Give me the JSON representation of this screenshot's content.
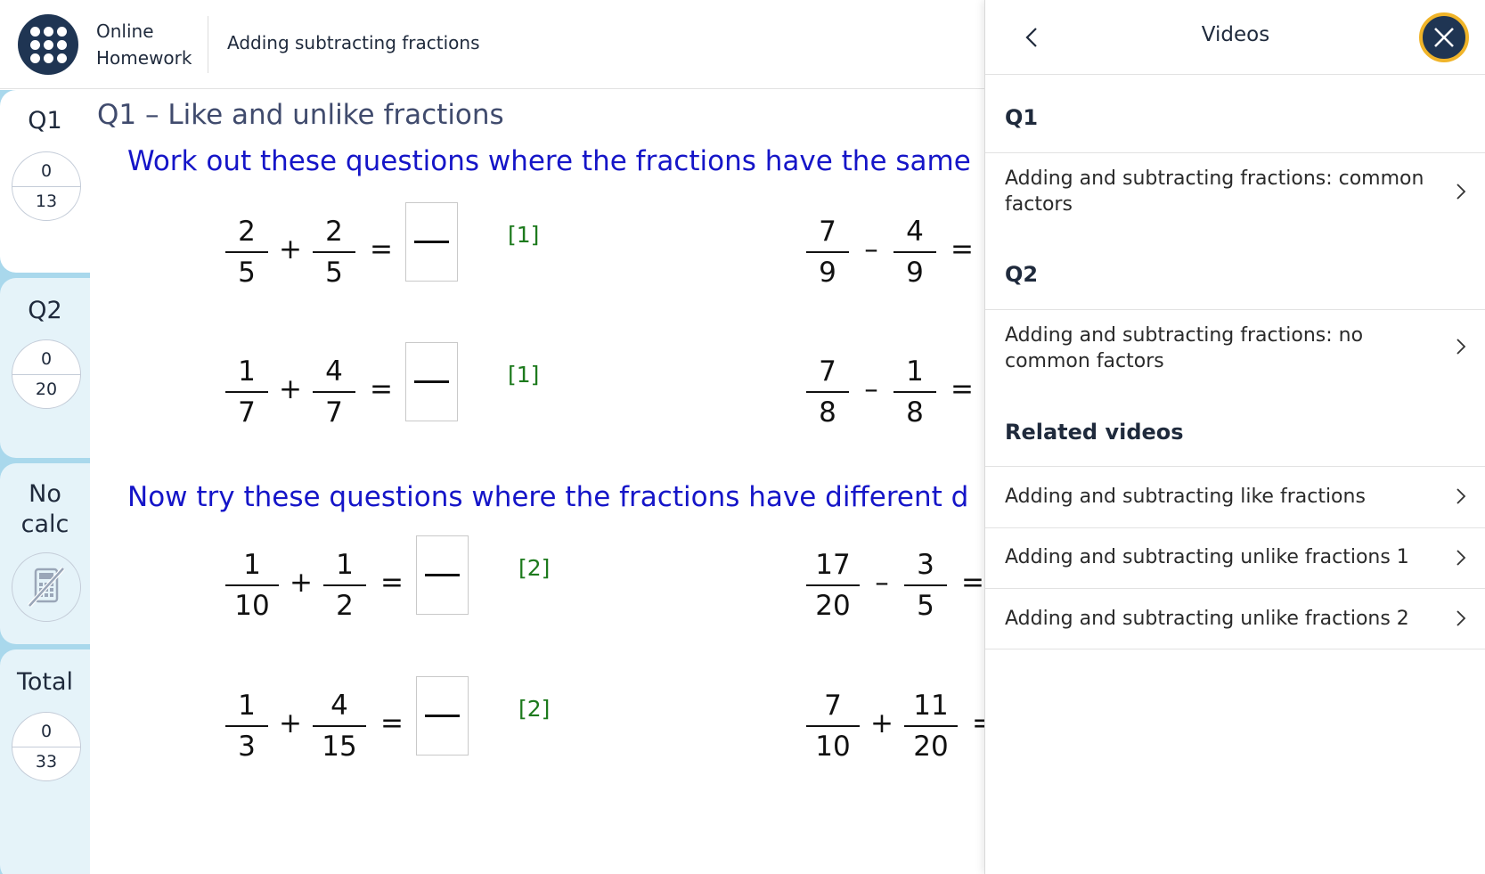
{
  "header": {
    "brand_line1": "Online",
    "brand_line2": "Homework",
    "homework_title": "Adding subtracting fractions"
  },
  "sidebar": {
    "items": [
      {
        "label": "Q1",
        "score": "0",
        "total": "13"
      },
      {
        "label": "Q2",
        "score": "0",
        "total": "20"
      },
      {
        "label_line1": "No",
        "label_line2": "calc",
        "icon": "calculator-off-icon"
      },
      {
        "label": "Total",
        "score": "0",
        "total": "33"
      }
    ]
  },
  "main": {
    "heading": "Q1 – Like and unlike fractions",
    "instruction1": "Work out these questions where the fractions have the same",
    "instruction2": "Now try these questions where the fractions have different d",
    "equals": "=",
    "problems": [
      {
        "a_num": "2",
        "a_den": "5",
        "op": "+",
        "b_num": "2",
        "b_den": "5",
        "marks": "[1]"
      },
      {
        "a_num": "7",
        "a_den": "9",
        "op": "–",
        "b_num": "4",
        "b_den": "9"
      },
      {
        "a_num": "1",
        "a_den": "7",
        "op": "+",
        "b_num": "4",
        "b_den": "7",
        "marks": "[1]"
      },
      {
        "a_num": "7",
        "a_den": "8",
        "op": "–",
        "b_num": "1",
        "b_den": "8"
      },
      {
        "a_num": "1",
        "a_den": "10",
        "op": "+",
        "b_num": "1",
        "b_den": "2",
        "marks": "[2]"
      },
      {
        "a_num": "17",
        "a_den": "20",
        "op": "–",
        "b_num": "3",
        "b_den": "5"
      },
      {
        "a_num": "1",
        "a_den": "3",
        "op": "+",
        "b_num": "4",
        "b_den": "15",
        "marks": "[2]"
      },
      {
        "a_num": "7",
        "a_den": "10",
        "op": "+",
        "b_num": "11",
        "b_den": "20"
      }
    ]
  },
  "panel": {
    "title": "Videos",
    "sections": [
      {
        "title": "Q1",
        "videos": [
          "Adding and subtracting fractions: common factors"
        ]
      },
      {
        "title": "Q2",
        "videos": [
          "Adding and subtracting fractions: no common factors"
        ]
      },
      {
        "title": "Related videos",
        "videos": [
          "Adding and subtracting like fractions",
          "Adding and subtracting unlike fractions 1",
          "Adding and subtracting unlike fractions 2"
        ]
      }
    ]
  },
  "colors": {
    "navy": "#1f3553",
    "instruction_blue": "#1515c8",
    "marks_green": "#1d7a1d",
    "sidebar_blue": "#a9d8ec",
    "close_ring": "#f0b429"
  }
}
